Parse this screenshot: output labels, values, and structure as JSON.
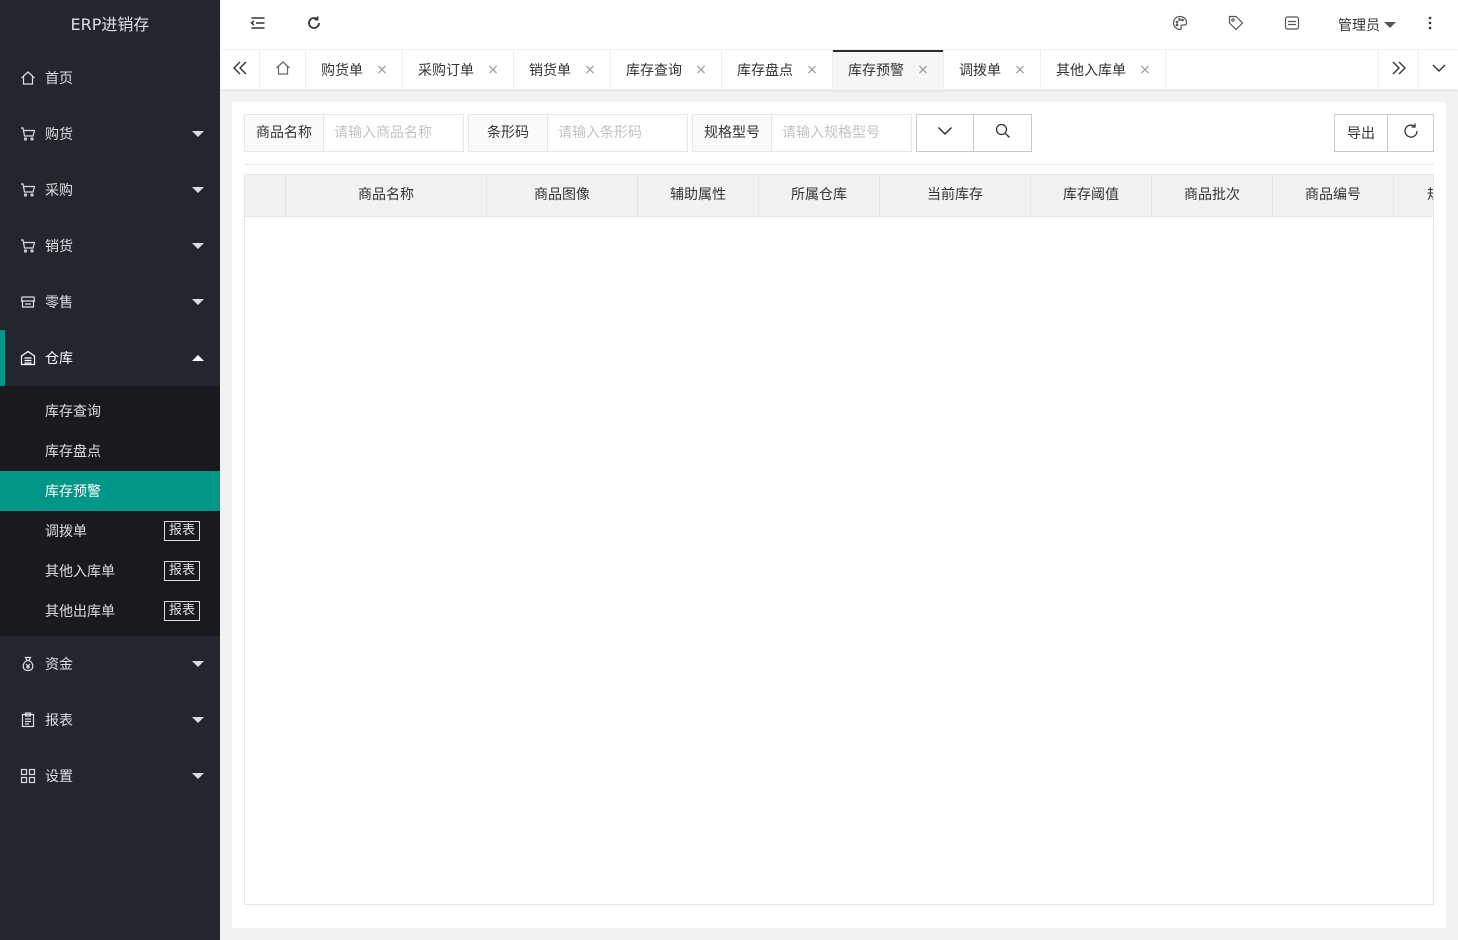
{
  "app": {
    "title": "ERP进销存"
  },
  "sidebar": {
    "items": [
      {
        "label": "首页",
        "icon": "home-icon"
      },
      {
        "label": "购货",
        "icon": "cart-icon"
      },
      {
        "label": "采购",
        "icon": "cart-icon"
      },
      {
        "label": "销货",
        "icon": "cart-icon"
      },
      {
        "label": "零售",
        "icon": "store-icon"
      },
      {
        "label": "仓库",
        "icon": "warehouse-icon",
        "open": true
      },
      {
        "label": "资金",
        "icon": "money-bag-icon"
      },
      {
        "label": "报表",
        "icon": "clipboard-icon"
      },
      {
        "label": "设置",
        "icon": "grid-icon"
      }
    ],
    "warehouse_sub": [
      {
        "label": "库存查询"
      },
      {
        "label": "库存盘点"
      },
      {
        "label": "库存预警",
        "active": true
      },
      {
        "label": "调拨单",
        "badge": "报表"
      },
      {
        "label": "其他入库单",
        "badge": "报表"
      },
      {
        "label": "其他出库单",
        "badge": "报表"
      }
    ]
  },
  "header": {
    "user": "管理员",
    "icons": [
      "menu-fold-icon",
      "refresh-icon",
      "palette-icon",
      "tag-icon",
      "message-icon",
      "more-vertical-icon"
    ]
  },
  "tabs": {
    "items": [
      {
        "label": "购货单"
      },
      {
        "label": "采购订单"
      },
      {
        "label": "销货单"
      },
      {
        "label": "库存查询"
      },
      {
        "label": "库存盘点"
      },
      {
        "label": "库存预警",
        "active": true
      },
      {
        "label": "调拨单"
      },
      {
        "label": "其他入库单"
      }
    ]
  },
  "search": {
    "name_label": "商品名称",
    "name_placeholder": "请输入商品名称",
    "barcode_label": "条形码",
    "barcode_placeholder": "请输入条形码",
    "spec_label": "规格型号",
    "spec_placeholder": "请输入规格型号"
  },
  "toolbar": {
    "export_label": "导出"
  },
  "table": {
    "columns": [
      "",
      "商品名称",
      "商品图像",
      "辅助属性",
      "所属仓库",
      "当前库存",
      "库存阈值",
      "商品批次",
      "商品编号",
      "规"
    ]
  },
  "colors": {
    "sidebar_bg": "#23262e",
    "submenu_bg": "#191a20",
    "accent": "#009688"
  }
}
